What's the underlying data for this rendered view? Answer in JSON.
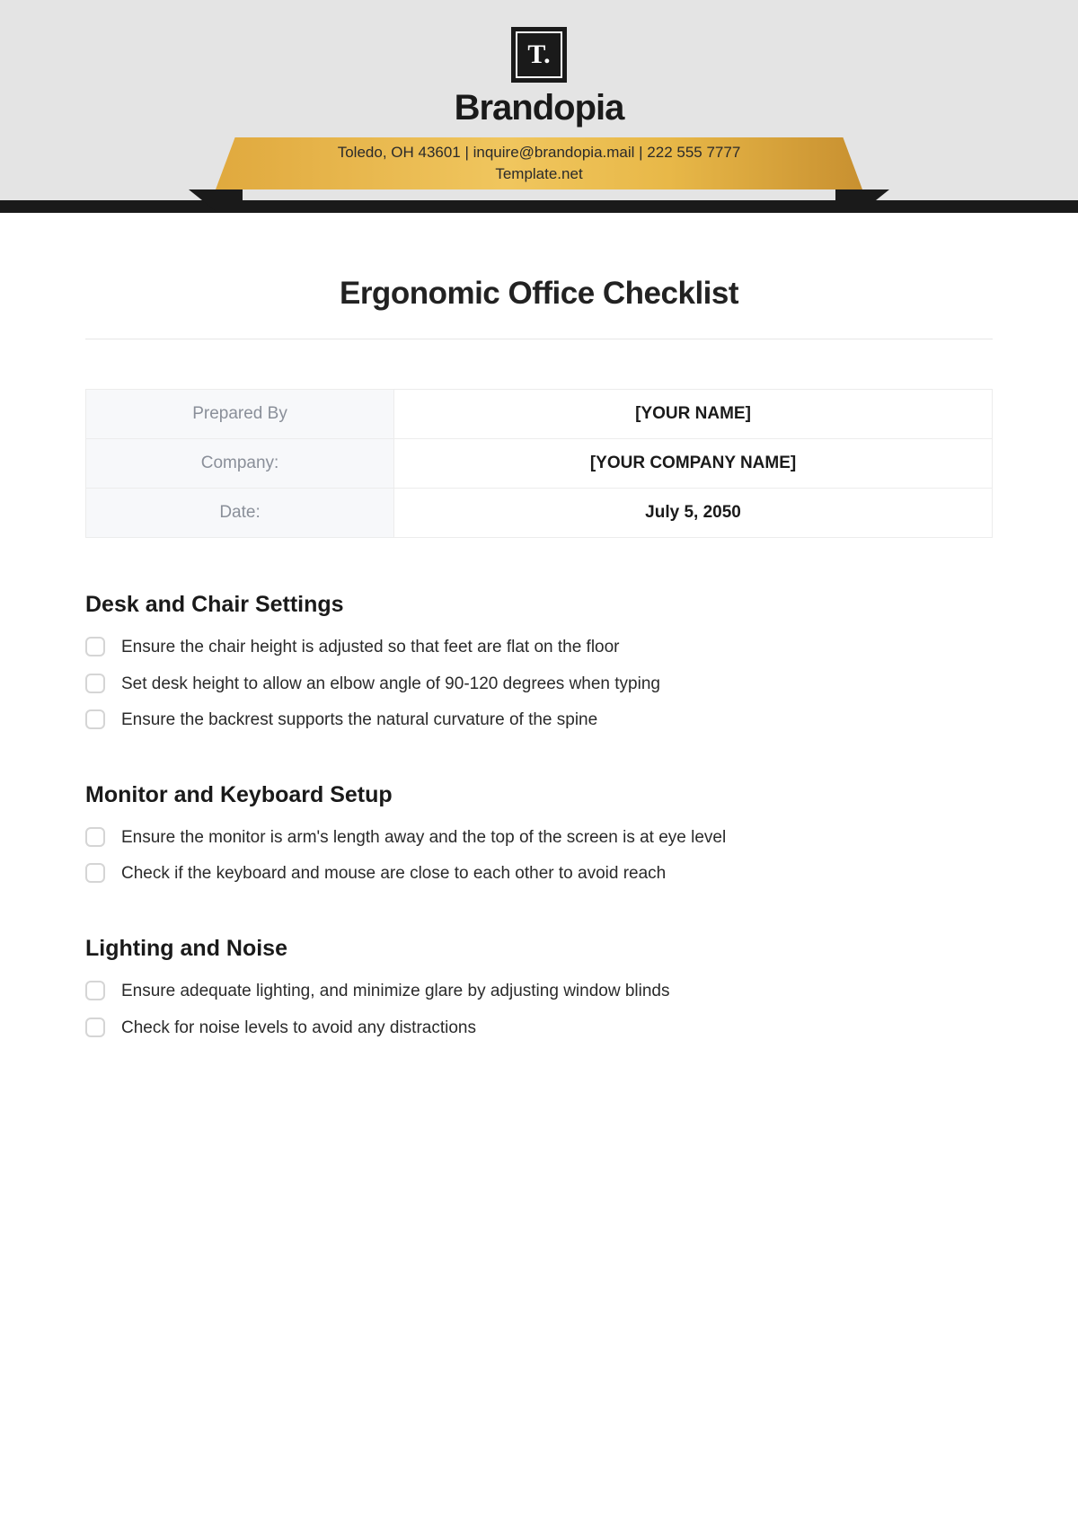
{
  "header": {
    "logo_text": "T.",
    "brand": "Brandopia",
    "ribbon_line1": "Toledo, OH 43601 | inquire@brandopia.mail | 222 555 7777",
    "ribbon_line2": "Template.net"
  },
  "title": "Ergonomic Office Checklist",
  "meta": {
    "prepared_by_label": "Prepared By",
    "prepared_by_value": "[YOUR NAME]",
    "company_label": "Company:",
    "company_value": "[YOUR COMPANY NAME]",
    "date_label": "Date:",
    "date_value": "July 5, 2050"
  },
  "sections": [
    {
      "title": "Desk and Chair Settings",
      "items": [
        "Ensure the chair height is adjusted so that feet are flat on the floor",
        "Set desk height to allow an elbow angle of 90-120 degrees when typing",
        "Ensure the backrest supports the natural curvature of the spine"
      ]
    },
    {
      "title": "Monitor and Keyboard Setup",
      "items": [
        "Ensure the monitor is arm's length away and the top of the screen is at eye level",
        "Check if the keyboard and mouse are close to each other to avoid reach"
      ]
    },
    {
      "title": "Lighting and Noise",
      "items": [
        "Ensure adequate lighting, and minimize glare by adjusting window blinds",
        "Check for noise levels to avoid any distractions"
      ]
    }
  ]
}
